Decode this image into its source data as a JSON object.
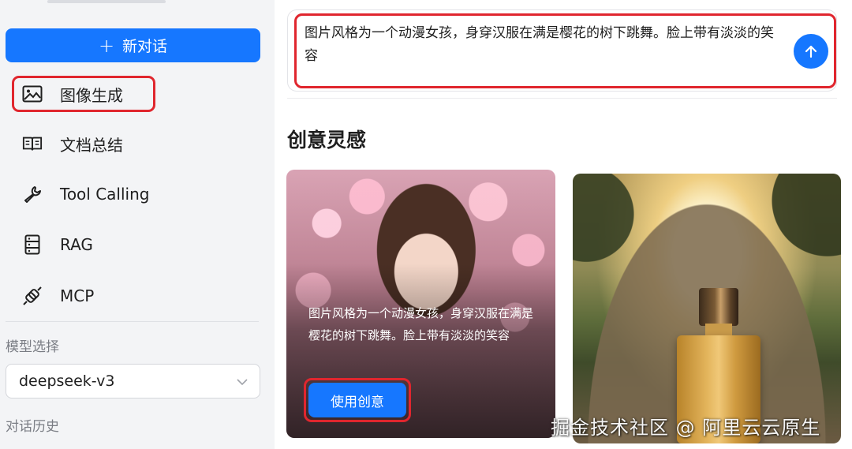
{
  "sidebar": {
    "new_chat_label": "新对话",
    "nav_items": [
      {
        "label": "图像生成",
        "icon": "image-icon"
      },
      {
        "label": "文档总结",
        "icon": "book-icon"
      },
      {
        "label": "Tool Calling",
        "icon": "wrench-icon"
      },
      {
        "label": "RAG",
        "icon": "database-icon"
      },
      {
        "label": "MCP",
        "icon": "plug-icon"
      }
    ],
    "model_section_label": "模型选择",
    "model_value": "deepseek-v3",
    "history_section_label": "对话历史"
  },
  "main": {
    "input_text": "图片风格为一个动漫女孩，身穿汉服在满是樱花的树下跳舞。脸上带有淡淡的笑容",
    "section_title": "创意灵感",
    "cards": [
      {
        "caption": "图片风格为一个动漫女孩，身穿汉服在满是樱花的树下跳舞。脸上带有淡淡的笑容",
        "button_label": "使用创意"
      }
    ],
    "watermark": "掘金技术社区 @ 阿里云云原生"
  },
  "colors": {
    "primary": "#1677ff",
    "highlight": "#e0262e",
    "sidebar_bg": "#f3f4f6"
  }
}
